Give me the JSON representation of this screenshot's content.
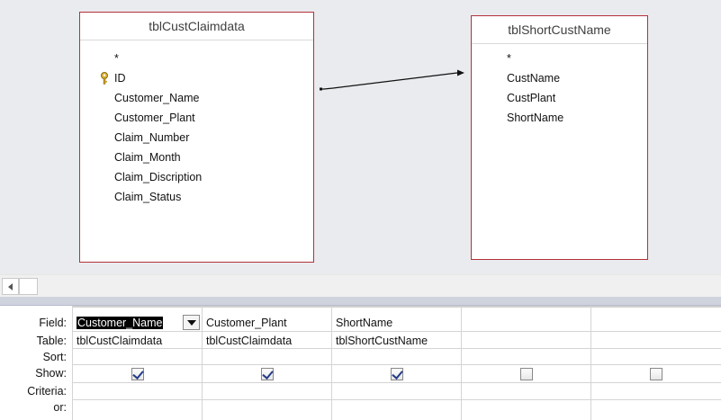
{
  "tables": [
    {
      "name": "tblCustClaimdata",
      "fields": [
        "*",
        "ID",
        "Customer_Name",
        "Customer_Plant",
        "Claim_Number",
        "Claim_Month",
        "Claim_Discription",
        "Claim_Status"
      ],
      "primary_key": "ID"
    },
    {
      "name": "tblShortCustName",
      "fields": [
        "*",
        "CustName",
        "CustPlant",
        "ShortName"
      ]
    }
  ],
  "grid": {
    "row_labels": [
      "Field:",
      "Table:",
      "Sort:",
      "Show:",
      "Criteria:",
      "or:"
    ],
    "columns": [
      {
        "field": "Customer_Name",
        "table": "tblCustClaimdata",
        "sort": "",
        "show": true,
        "criteria": "",
        "or": "",
        "selected": true
      },
      {
        "field": "Customer_Plant",
        "table": "tblCustClaimdata",
        "sort": "",
        "show": true,
        "criteria": "",
        "or": ""
      },
      {
        "field": "ShortName",
        "table": "tblShortCustName",
        "sort": "",
        "show": true,
        "criteria": "",
        "or": ""
      },
      {
        "field": "",
        "table": "",
        "sort": "",
        "show": false,
        "criteria": "",
        "or": ""
      },
      {
        "field": "",
        "table": "",
        "sort": "",
        "show": false,
        "criteria": "",
        "or": ""
      }
    ]
  }
}
